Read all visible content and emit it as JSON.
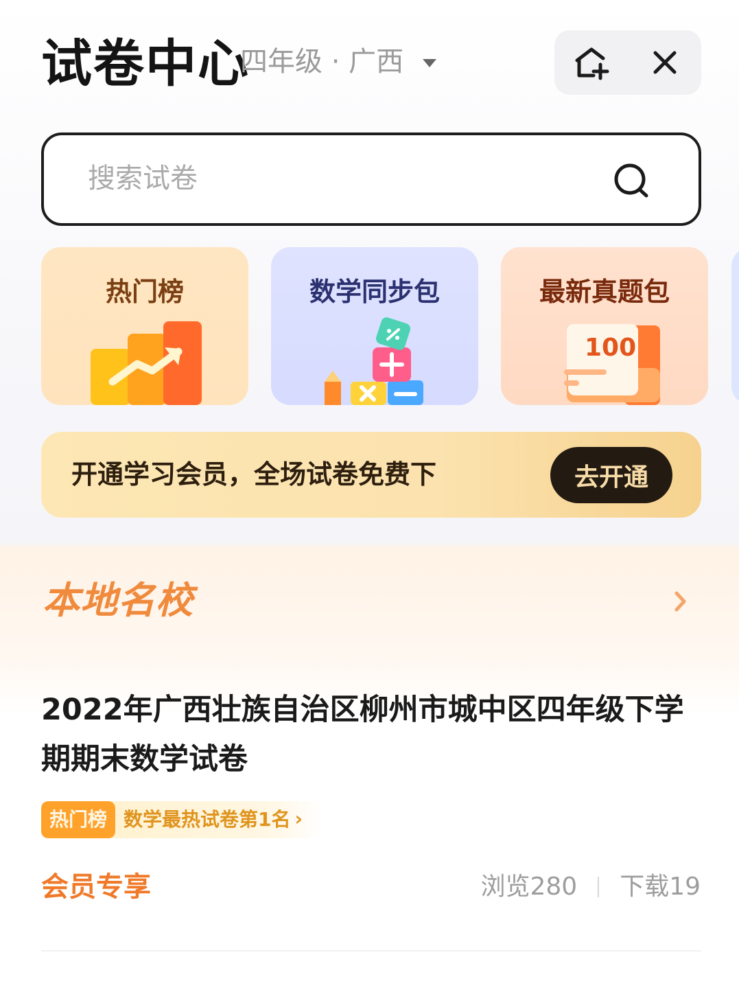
{
  "header": {
    "title": "试卷中心",
    "grade_region": "四年级 · 广西",
    "actions": [
      "add-to-home",
      "close"
    ]
  },
  "search": {
    "placeholder": "搜索试卷"
  },
  "cards": [
    {
      "label": "热门榜",
      "icon": "bar-chart-trend-icon"
    },
    {
      "label": "数学同步包",
      "icon": "math-blocks-icon"
    },
    {
      "label": "最新真题包",
      "icon": "score-100-icon",
      "icon_text": "100"
    }
  ],
  "banner": {
    "text": "开通学习会员，全场试卷免费下",
    "button": "去开通"
  },
  "local_schools": {
    "title": "本地名校",
    "papers": [
      {
        "title": "2022年广西壮族自治区柳州市城中区四年级下学期期末数学试卷",
        "rank_badge": "热门榜",
        "rank_text": "数学最热试卷第1名",
        "rank_chevron": "›",
        "access": "会员专享",
        "views": "浏览280",
        "downloads": "下载19"
      }
    ]
  },
  "colors": {
    "accent_orange": "#f07a2a",
    "section_title": "#f08a3c",
    "cta_dark": "#231a12",
    "badge_orange": "#ffa22b"
  }
}
